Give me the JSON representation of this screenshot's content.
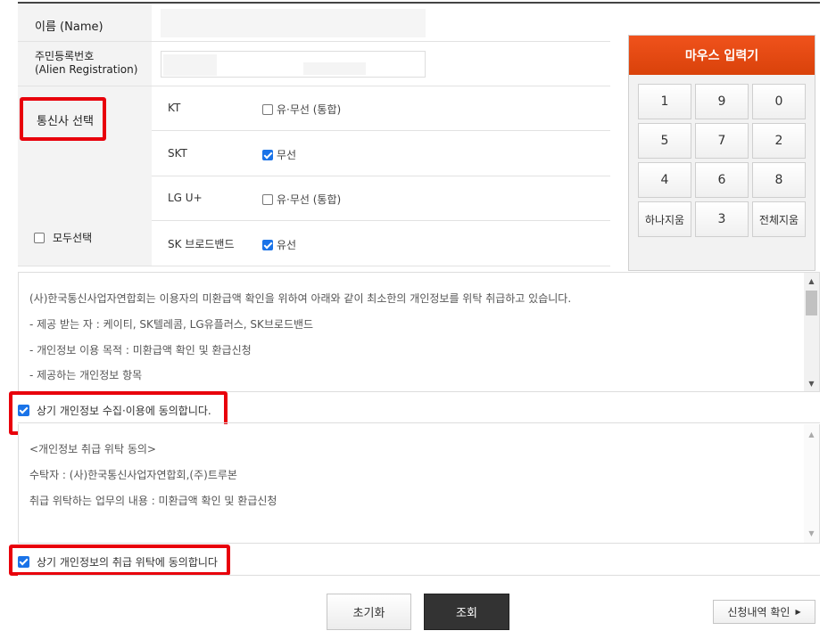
{
  "form": {
    "name_label": "이름 (Name)",
    "reg_label_ko": "주민등록번호",
    "reg_label_en": "(Alien Registration)",
    "carrier_select_label": "통신사 선택",
    "select_all_label": "모두선택",
    "carriers": [
      {
        "name": "KT",
        "option": "유·무선 (통합)",
        "checked": false
      },
      {
        "name": "SKT",
        "option": "무선",
        "checked": true
      },
      {
        "name": "LG U+",
        "option": "유·무선 (통합)",
        "checked": false
      },
      {
        "name": "SK 브로드밴드",
        "option": "유선",
        "checked": true
      }
    ]
  },
  "keypad": {
    "title": "마우스 입력기",
    "keys": [
      "1",
      "9",
      "0",
      "5",
      "7",
      "2",
      "4",
      "6",
      "8",
      "하나지움",
      "3",
      "전체지움"
    ]
  },
  "terms1": {
    "lines": [
      "(사)한국통신사업자연합회는 이용자의 미환급액 확인을 위하여 아래와 같이 최소한의 개인정보를 위탁 취급하고 있습니다.",
      "- 제공 받는 자 : 케이티, SK텔레콤, LG유플러스, SK브로드밴드",
      "- 개인정보 이용 목적 : 미환급액 확인 및 환급신청",
      "- 제공하는 개인정보 항목"
    ],
    "agree_label": "상기 개인정보 수집·이용에 동의합니다."
  },
  "terms2": {
    "lines": [
      "<개인정보 취급 위탁 동의>",
      "수탁자 : (사)한국통신사업자연합회,(주)트루본",
      "취급 위탁하는 업무의 내용 : 미환급액 확인 및 환급신청"
    ],
    "agree_label": "상기 개인정보의 취급 위탁에 동의합니다"
  },
  "buttons": {
    "reset": "초기화",
    "search": "조회",
    "history": "신청내역 확인"
  },
  "colors": {
    "highlight": "#e8000b",
    "keypad_header": "#e53e00",
    "checkbox": "#1a73e8"
  }
}
